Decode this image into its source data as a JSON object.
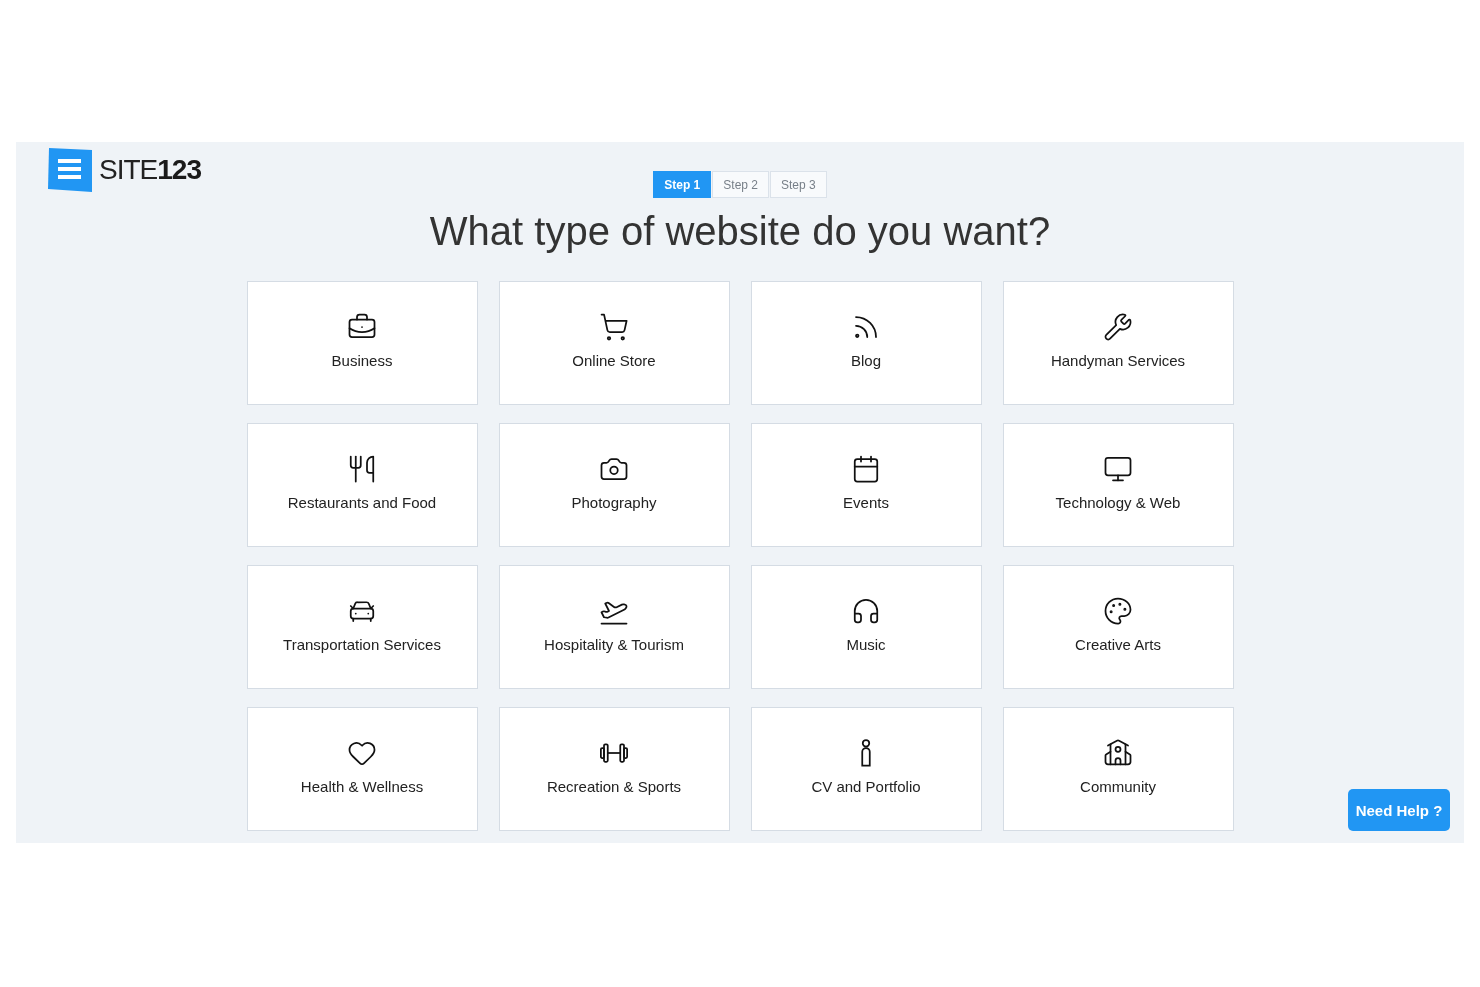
{
  "logo": {
    "text": "SITE**123**"
  },
  "steps": [
    {
      "label": "Step 1",
      "selected": true
    },
    {
      "label": "Step 2",
      "selected": false
    },
    {
      "label": "Step 3",
      "selected": false
    }
  ],
  "title": "What type of website do you want?",
  "categories": [
    "Business",
    "Online Store",
    "Blog",
    "Handyman Services",
    "Restaurants and Food",
    "Photography",
    "Events",
    "Technology & Web",
    "Transportation Services",
    "Hospitality & Tourism",
    "Music",
    "Creative Arts",
    "Health & Wellness",
    "Recreation & Sports",
    "CV and Portfolio",
    "Community"
  ],
  "help_button": {
    "label": "Need Help ?"
  }
}
